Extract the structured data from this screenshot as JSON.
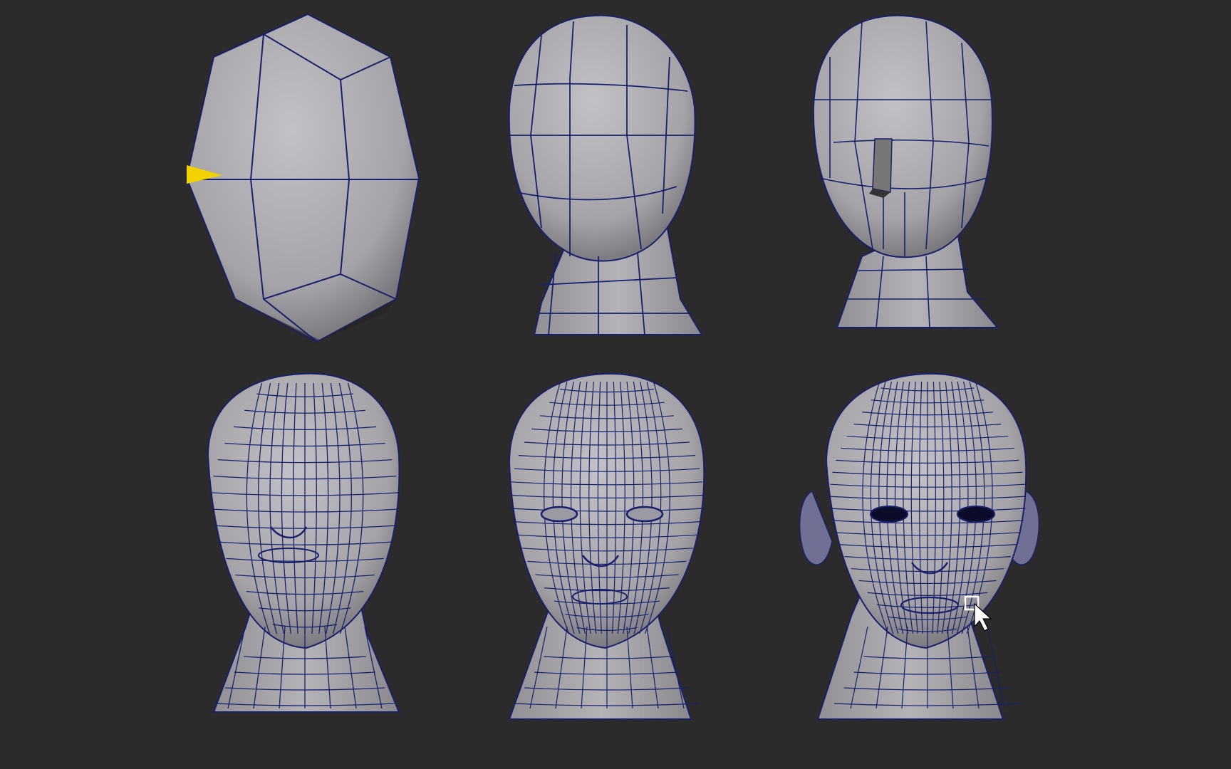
{
  "viewport": {
    "background": "#2b2b2b",
    "mesh_fill": "#a9a9ad",
    "mesh_shadow": "#5a5a5e",
    "wire_color": "#1a1f6b",
    "dark_inner": "#0b0c2a",
    "gizmo_color": "#f2d200"
  },
  "stages": [
    {
      "name": "stage-1-base-cube",
      "subdivision": 1
    },
    {
      "name": "stage-2-head-neck",
      "subdivision": 2
    },
    {
      "name": "stage-3-nose-block",
      "subdivision": 3
    },
    {
      "name": "stage-4-face-loops",
      "subdivision": 4
    },
    {
      "name": "stage-5-eye-sockets",
      "subdivision": 5
    },
    {
      "name": "stage-6-ears-detail",
      "subdivision": 6
    }
  ],
  "icons": {
    "gizmo": "move-manipulator-icon",
    "cursor": "mouse-pointer-icon"
  }
}
